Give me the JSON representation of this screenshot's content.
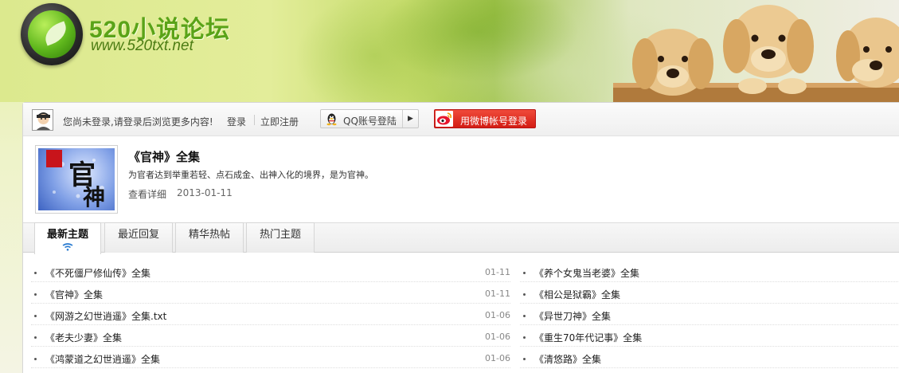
{
  "header": {
    "site_name": "520小说论坛",
    "site_url": "www.520txt.net"
  },
  "login_bar": {
    "prompt": "您尚未登录,请登录后浏览更多内容!",
    "login": "登录",
    "register": "立即注册",
    "qq_login": "QQ账号登陆",
    "weibo_login": "用微博帐号登录"
  },
  "forum": {
    "title": "《官神》全集",
    "description": "为官者达到举重若轻、点石成金、出神入化的境界，是为官神。",
    "detail_link": "查看详细",
    "date": "2013-01-11",
    "cover_chars": [
      "官",
      "神"
    ]
  },
  "tabs": [
    {
      "label": "最新主题",
      "active": true
    },
    {
      "label": "最近回复",
      "active": false
    },
    {
      "label": "精华热帖",
      "active": false
    },
    {
      "label": "热门主题",
      "active": false
    }
  ],
  "threads_left": [
    {
      "title": "《不死僵尸修仙传》全集",
      "date": "01-11"
    },
    {
      "title": "《官神》全集",
      "date": "01-11"
    },
    {
      "title": "《网游之幻世逍遥》全集.txt",
      "date": "01-06"
    },
    {
      "title": "《老夫少妻》全集",
      "date": "01-06"
    },
    {
      "title": "《鸿蒙道之幻世逍遥》全集",
      "date": "01-06"
    }
  ],
  "threads_right": [
    {
      "title": "《养个女鬼当老婆》全集"
    },
    {
      "title": "《相公是狱霸》全集"
    },
    {
      "title": "《异世刀神》全集"
    },
    {
      "title": "《重生70年代记事》全集"
    },
    {
      "title": "《清悠路》全集"
    }
  ],
  "colors": {
    "brand_green": "#5aa318",
    "weibo_red": "#d31d14"
  }
}
